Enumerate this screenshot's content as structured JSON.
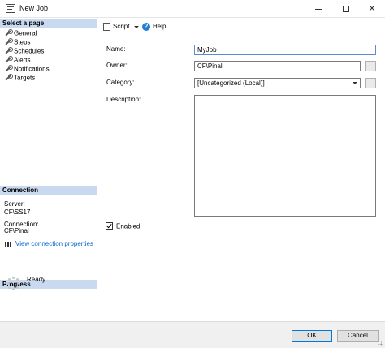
{
  "window": {
    "title": "New Job"
  },
  "left_pane": {
    "select_page_header": "Select a page",
    "pages": [
      {
        "label": "General",
        "icon": "wrench-icon"
      },
      {
        "label": "Steps",
        "icon": "wrench-icon"
      },
      {
        "label": "Schedules",
        "icon": "wrench-icon"
      },
      {
        "label": "Alerts",
        "icon": "wrench-icon"
      },
      {
        "label": "Notifications",
        "icon": "wrench-icon"
      },
      {
        "label": "Targets",
        "icon": "wrench-icon"
      }
    ],
    "connection_header": "Connection",
    "server_label": "Server:",
    "server_value": "CF\\SS17",
    "connection_label": "Connection:",
    "connection_value": "CF\\Pinal",
    "view_connection_link": "View connection properties",
    "progress_header": "Progress",
    "progress_status": "Ready"
  },
  "toolbar": {
    "script_label": "Script",
    "help_label": "Help"
  },
  "form": {
    "name_label": "Name:",
    "name_value": "MyJob",
    "owner_label": "Owner:",
    "owner_value": "CF\\Pinal",
    "owner_browse": "...",
    "category_label": "Category:",
    "category_value": "[Uncategorized (Local)]",
    "category_browse": "...",
    "description_label": "Description:",
    "description_value": "",
    "enabled_label": "Enabled",
    "enabled_checked": true
  },
  "buttons": {
    "ok_label": "OK",
    "cancel_label": "Cancel"
  },
  "colors": {
    "section_header_bg": "#c9d9f0",
    "link": "#0066cc",
    "ok_border": "#0078d7"
  }
}
